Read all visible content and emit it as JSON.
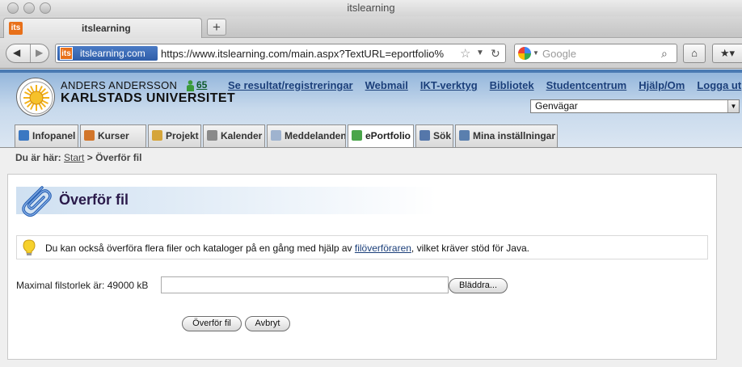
{
  "window": {
    "title": "itslearning"
  },
  "browser": {
    "tab_label": "itslearning",
    "favicon_text": "its",
    "new_tab_symbol": "+",
    "identity_site": "itslearning.com",
    "url": "https://www.itslearning.com/main.aspx?TextURL=eportfolio%",
    "search_placeholder": "Google",
    "icons": {
      "back": "back-arrow-icon",
      "forward": "forward-arrow-icon",
      "bookmark": "star-icon",
      "reload": "reload-icon",
      "search": "magnifier-icon",
      "home": "home-icon"
    }
  },
  "header": {
    "user_name": "ANDERS ANDERSSON",
    "university": "KARLSTADS UNIVERSITET",
    "online_count": "65",
    "top_links": [
      "Se resultat/registreringar",
      "Webmail",
      "IKT-verktyg",
      "Bibliotek",
      "Studentcentrum",
      "Hjälp/Om",
      "Logga ut"
    ],
    "shortcut_select": "Genvägar"
  },
  "tabs": [
    {
      "label": "Infopanel",
      "icon": "infopanel-icon",
      "color": "#3b78c2"
    },
    {
      "label": "Kurser",
      "icon": "courses-icon",
      "color": "#d2762b"
    },
    {
      "label": "Projekt",
      "icon": "project-icon",
      "color": "#d5a53a"
    },
    {
      "label": "Kalender",
      "icon": "calendar-icon",
      "color": "#8a8a8a"
    },
    {
      "label": "Meddelanden",
      "icon": "envelope-icon",
      "color": "#9fb3cf"
    },
    {
      "label": "ePortfolio",
      "icon": "eportfolio-icon",
      "color": "#4aa54a"
    },
    {
      "label": "Sök",
      "icon": "search-icon",
      "color": "#5577aa"
    },
    {
      "label": "Mina inställningar",
      "icon": "settings-icon",
      "color": "#5a7fae"
    }
  ],
  "active_tab": "ePortfolio",
  "breadcrumb": {
    "prefix": "Du är här:",
    "start_link": "Start",
    "separator": ">",
    "current": "Överför fil"
  },
  "panel": {
    "title": "Överför fil",
    "info": {
      "text_before": "Du kan också överföra flera filer och kataloger på en gång med hjälp av ",
      "link": "filöverföraren",
      "text_after": ", vilket kräver stöd för Java."
    },
    "max_size_label": "Maximal filstorlek är: 49000 kB",
    "file_value": "",
    "browse_label": "Bläddra...",
    "upload_label": "Överför fil",
    "cancel_label": "Avbryt"
  }
}
